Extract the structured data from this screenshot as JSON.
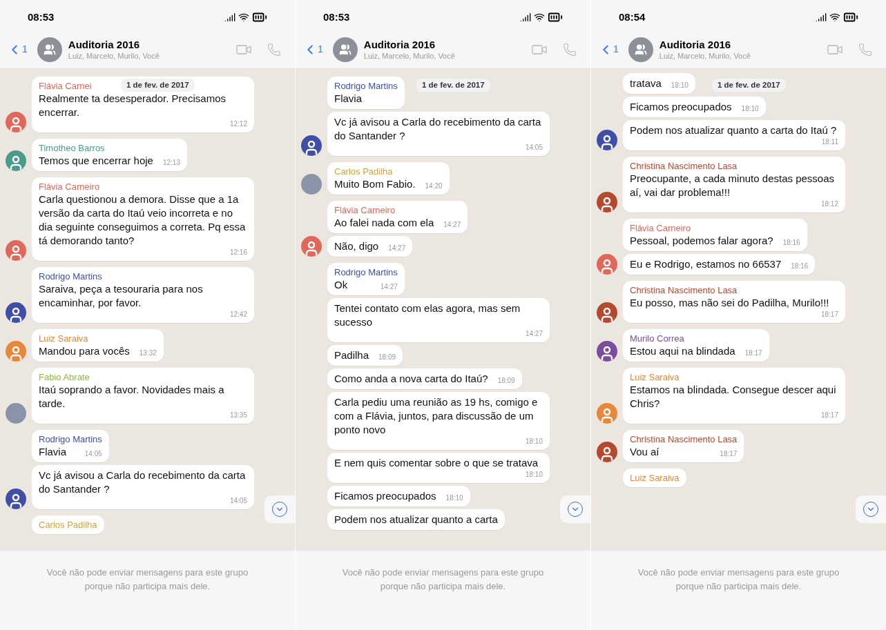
{
  "panels": [
    {
      "status_time": "08:53",
      "back_count": "1",
      "title": "Auditoria 2016",
      "subtitle": "Luiz, Marcelo, Murilo, Você",
      "date_pill": "1 de fev. de 2017",
      "messages": [
        {
          "sender": "Flávia Carnei",
          "color": "#e0675a",
          "text": "Realmente ta desesperador. Precisamos encerrar.",
          "time": "12:12",
          "avatar": {
            "kind": "person",
            "color": "#e0675a"
          }
        },
        {
          "sender": "Timotheo Barros",
          "color": "#4a9b8a",
          "text": "Temos que encerrar hoje",
          "time": "12:13",
          "avatar": {
            "kind": "person",
            "color": "#4a9b8a"
          }
        },
        {
          "sender": "Flávia Carneiro",
          "color": "#e0675a",
          "text": "Carla questionou a demora. Disse que a 1a versão da carta do Itaú veio incorreta e no dia seguinte conseguimos a correta. Pq essa tá demorando tanto?",
          "time": "12:16",
          "avatar": {
            "kind": "person",
            "color": "#e0675a"
          }
        },
        {
          "sender": "Rodrigo Martins",
          "color": "#3f4fa8",
          "text": "Saraiva, peça a tesouraria para nos encaminhar, por favor.",
          "time": "12:42",
          "avatar": {
            "kind": "person",
            "color": "#3f4fa8"
          }
        },
        {
          "sender": "Luiz Saraiva",
          "color": "#e8873a",
          "text": "Mandou para vocês",
          "time": "13:32",
          "avatar": {
            "kind": "person",
            "color": "#e8873a"
          }
        },
        {
          "sender": "Fabio Abrate",
          "color": "#8cbd3f",
          "text": "Itaú soprando a favor. Novidades mais a tarde.",
          "time": "13:35",
          "avatar": {
            "kind": "photo"
          }
        },
        {
          "sender": "Rodrigo Martins",
          "color": "#3f4fa8",
          "text": "Flavia",
          "time": "14:05"
        },
        {
          "text": "Vc já avisou a Carla do recebimento da carta do Santander ?",
          "time": "14:05",
          "avatar": {
            "kind": "person",
            "color": "#3f4fa8"
          }
        },
        {
          "sender": "Carlos Padilha",
          "color": "#d0a43a"
        }
      ],
      "footer_notice": "Você não pode enviar mensagens para este grupo porque não participa mais dele."
    },
    {
      "status_time": "08:53",
      "back_count": "1",
      "title": "Auditoria 2016",
      "subtitle": "Luiz, Marcelo, Murilo, Você",
      "date_pill": "1 de fev. de 2017",
      "messages": [
        {
          "sender": "Rodrigo Martins",
          "color": "#3f4fa8",
          "text": "Flavia"
        },
        {
          "text": "Vc já avisou a Carla do recebimento da carta do Santander ?",
          "time": "14:05",
          "avatar": {
            "kind": "person",
            "color": "#3f4fa8"
          }
        },
        {
          "sender": "Carlos Padilha",
          "color": "#d0a43a",
          "text": "Muito Bom Fabio.",
          "time": "14:20",
          "avatar": {
            "kind": "photo"
          }
        },
        {
          "sender": "Flávia Carneiro",
          "color": "#e0675a",
          "text": "Ao falei nada com ela",
          "time": "14:27"
        },
        {
          "text": "Não, digo",
          "time": "14:27",
          "avatar": {
            "kind": "person",
            "color": "#e0675a"
          }
        },
        {
          "sender": "Rodrigo Martins",
          "color": "#3f4fa8",
          "text": "Ok",
          "time": "14:27"
        },
        {
          "text": "Tentei contato com elas agora, mas sem sucesso",
          "time": "14:27"
        },
        {
          "text": "Padilha",
          "time": "18:09"
        },
        {
          "text": "Como anda a nova carta do Itaú?",
          "time": "18:09"
        },
        {
          "text": "Carla pediu uma reunião as 19 hs, comigo e com a Flávia, juntos, para discussão de um ponto novo",
          "time": "18:10"
        },
        {
          "text": "E nem quis comentar sobre o que se tratava",
          "time": "18:10"
        },
        {
          "text": "Ficamos preocupados",
          "time": "18:10"
        },
        {
          "text": "Podem nos atualizar quanto a carta"
        }
      ],
      "footer_notice": "Você não pode enviar mensagens para este grupo porque não participa mais dele."
    },
    {
      "status_time": "08:54",
      "back_count": "1",
      "title": "Auditoria 2016",
      "subtitle": "Luiz, Marcelo, Murilo, Você",
      "date_pill": "1 de fev. de 2017",
      "messages": [
        {
          "text": "tratava",
          "time": "18:10"
        },
        {
          "text": "Ficamos preocupados",
          "time": "18:10"
        },
        {
          "text": "Podem nos atualizar quanto a carta do Itaú ?",
          "time": "18:11",
          "avatar": {
            "kind": "person",
            "color": "#3f4fa8"
          }
        },
        {
          "sender": "Christina Nascimento Lasa",
          "color": "#b5482f",
          "text": "Preocupante, a cada minuto destas pessoas aí, vai dar problema!!!",
          "time": "18:12",
          "avatar": {
            "kind": "person",
            "color": "#b5482f"
          }
        },
        {
          "sender": "Flávia Carneiro",
          "color": "#e0675a",
          "text": "Pessoal, podemos falar agora?",
          "time": "18:16"
        },
        {
          "text": "Eu e Rodrigo, estamos no 66537",
          "time": "18:16",
          "avatar": {
            "kind": "person",
            "color": "#e0675a"
          }
        },
        {
          "sender": "Christina Nascimento Lasa",
          "color": "#b5482f",
          "text": "Eu posso, mas não sei do Padilha, Murilo!!!",
          "time": "18:17",
          "avatar": {
            "kind": "person",
            "color": "#b5482f"
          }
        },
        {
          "sender": "Murilo Correa",
          "color": "#7b4d9e",
          "text": "Estou aqui na blindada",
          "time": "18:17",
          "avatar": {
            "kind": "person",
            "color": "#7b4d9e"
          }
        },
        {
          "sender": "Luiz Saraiva",
          "color": "#e8873a",
          "text": "Estamos na blindada. Consegue descer aqui Chris?",
          "time": "18:17",
          "avatar": {
            "kind": "person",
            "color": "#e8873a"
          }
        },
        {
          "sender": "Christina Nascimento Lasa",
          "color": "#b5482f",
          "text": "Vou aí",
          "time": "18:17",
          "avatar": {
            "kind": "person",
            "color": "#b5482f"
          }
        },
        {
          "sender": "Luiz Saraiva",
          "color": "#e8873a"
        }
      ],
      "footer_notice": "Você não pode enviar mensagens para este grupo porque não participa mais dele."
    }
  ]
}
